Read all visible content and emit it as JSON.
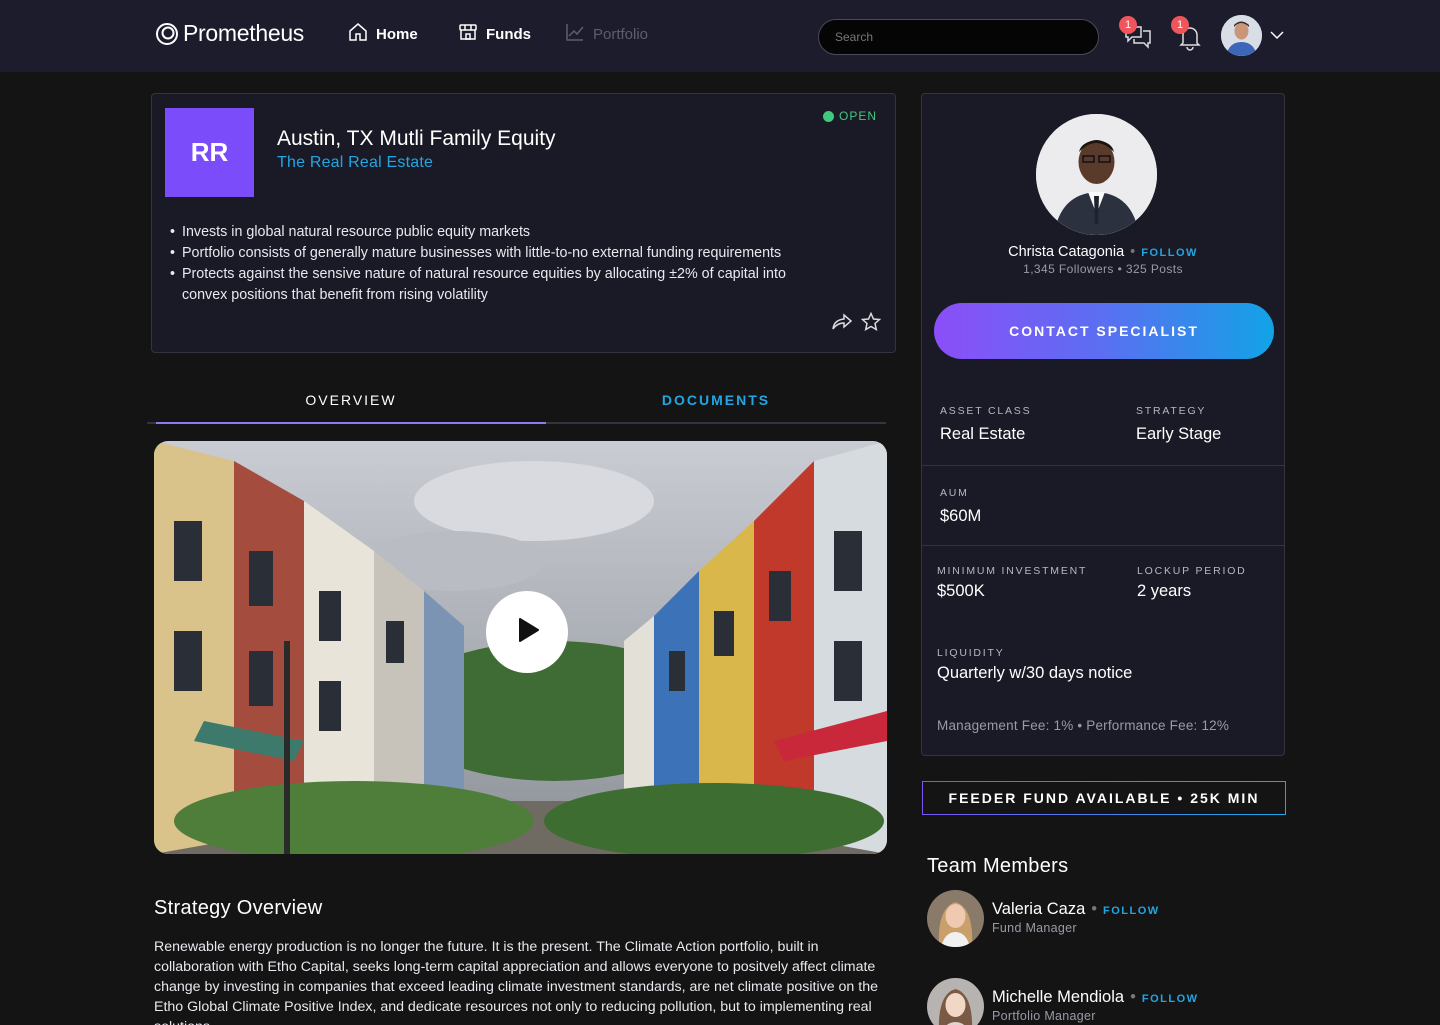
{
  "header": {
    "brand": "Prometheus",
    "nav": [
      {
        "label": "Home",
        "icon": "home-icon"
      },
      {
        "label": "Funds",
        "icon": "store-icon"
      },
      {
        "label": "Portfolio",
        "icon": "chart-line-icon"
      }
    ],
    "search_placeholder": "Search",
    "messages_badge": "1",
    "notifications_badge": "1"
  },
  "fund": {
    "logo_initials": "RR",
    "title": "Austin, TX Mutli Family Equity",
    "manager": "The Real Real Estate",
    "status": "OPEN",
    "bullets": [
      "Invests in global natural resource public equity markets",
      "Portfolio consists of generally mature businesses with little-to-no external funding requirements",
      "Protects against the sensive nature of natural resource equities by allocating ±2% of capital into convex positions that benefit from rising volatility"
    ]
  },
  "tabs": {
    "overview": "OVERVIEW",
    "documents": "DOCUMENTS"
  },
  "strategy": {
    "title": "Strategy Overview",
    "text": "Renewable energy production is no longer the future. It is the present. The Climate Action portfolio, built in collaboration with Etho Capital, seeks long-term capital appreciation and allows everyone to positvely affect climate change by investing in companies that exceed leading climate investment standards, are net climate positive on the Etho Global Climate Positive Index, and dedicate resources not only to reducing pollution, but to implementing real solutions."
  },
  "specialist": {
    "name": "Christa Catagonia",
    "follow": "FOLLOW",
    "stats": "1,345 Followers • 325 Posts",
    "contact_label": "CONTACT SPECIALIST"
  },
  "details": {
    "asset_class_label": "ASSET CLASS",
    "asset_class": "Real Estate",
    "strategy_label": "STRATEGY",
    "strategy": "Early Stage",
    "aum_label": "AUM",
    "aum": "$60M",
    "min_investment_label": "MINIMUM INVESTMENT",
    "min_investment": "$500K",
    "lockup_label": "LOCKUP PERIOD",
    "lockup": "2 years",
    "liquidity_label": "LIQUIDITY",
    "liquidity": "Quarterly w/30 days notice",
    "fees": "Management Fee: 1% • Performance Fee: 12%"
  },
  "feeder": "FEEDER FUND AVAILABLE • 25K MIN",
  "team": {
    "title": "Team Members",
    "members": [
      {
        "name": "Valeria Caza",
        "role": "Fund Manager",
        "follow": "FOLLOW"
      },
      {
        "name": "Michelle Mendiola",
        "role": "Portfolio Manager",
        "follow": "FOLLOW"
      }
    ]
  },
  "colors": {
    "accent_blue": "#22a6e3",
    "accent_purple": "#7b4dfa",
    "status_green": "#3fca7b",
    "badge_red": "#f0555b"
  }
}
